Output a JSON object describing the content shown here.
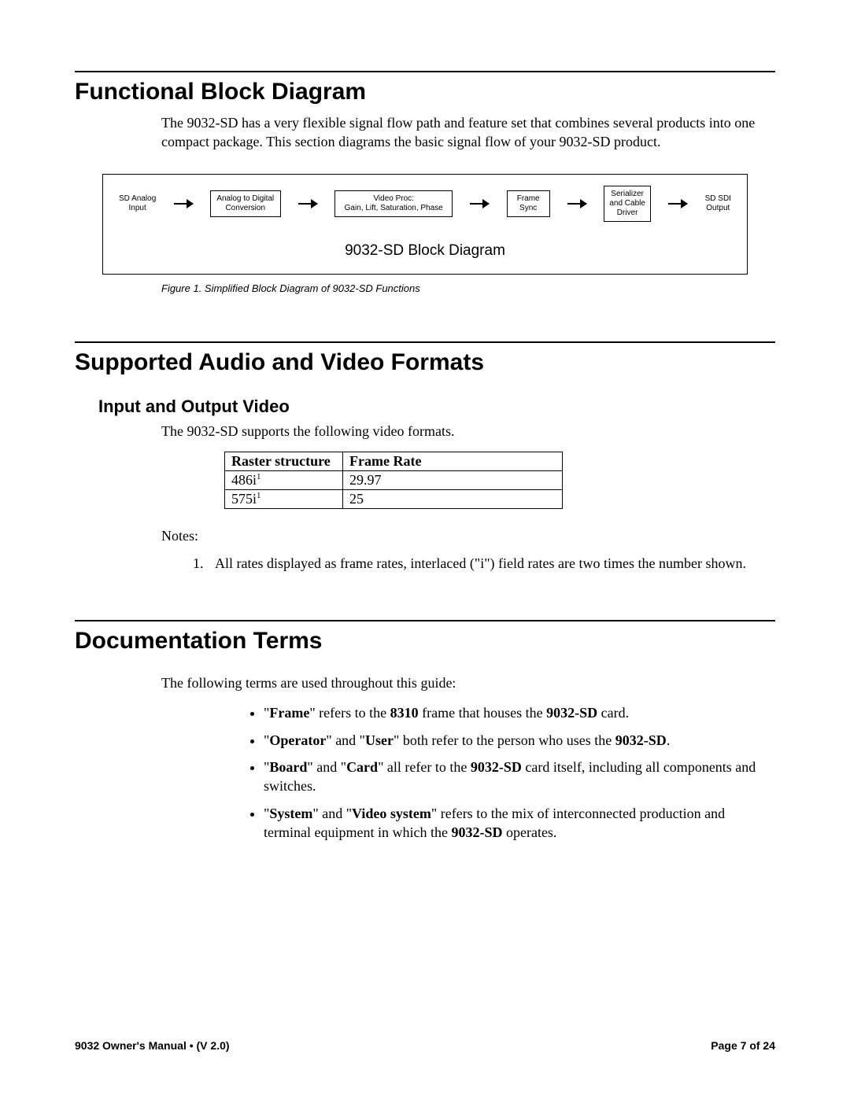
{
  "section1": {
    "heading": "Functional Block Diagram",
    "intro": "The 9032-SD has a very flexible signal flow path and feature set that combines several products into one compact package.  This section diagrams the basic signal flow of your 9032-SD product."
  },
  "diagram": {
    "nodes": {
      "input_l1": "SD Analog",
      "input_l2": "Input",
      "adc_l1": "Analog to Digital",
      "adc_l2": "Conversion",
      "proc_l1": "Video Proc:",
      "proc_l2": "Gain, Lift, Saturation, Phase",
      "frame_l1": "Frame",
      "frame_l2": "Sync",
      "ser_l1": "Serializer",
      "ser_l2": "and Cable",
      "ser_l3": "Driver",
      "output_l1": "SD SDI",
      "output_l2": "Output"
    },
    "caption": "9032-SD Block Diagram",
    "figure_caption": "Figure 1. Simplified Block Diagram of 9032-SD Functions"
  },
  "section2": {
    "heading": "Supported Audio and Video Formats",
    "sub_heading": "Input and Output Video",
    "intro": "The 9032-SD supports the following video formats."
  },
  "video_table": {
    "headers": {
      "c1": "Raster structure",
      "c2": "Frame Rate"
    },
    "rows": [
      {
        "raster": "486i",
        "sup": "1",
        "rate": "29.97"
      },
      {
        "raster": "575i",
        "sup": "1",
        "rate": "25"
      }
    ]
  },
  "notes": {
    "label": "Notes:",
    "items": [
      "All rates displayed as frame rates, interlaced (\"i\") field rates are two times the number shown."
    ]
  },
  "section3": {
    "heading": "Documentation Terms",
    "intro": "The following terms are used throughout this guide:"
  },
  "terms": {
    "t1": {
      "a": "\"",
      "b": "Frame",
      "c": "\" refers to the ",
      "d": "8310",
      "e": " frame that houses the ",
      "f": "9032-SD",
      "g": " card."
    },
    "t2": {
      "a": " \"",
      "b": "Operator",
      "c": "\" and \"",
      "d": "User",
      "e": "\" both refer to the person who uses the ",
      "f": "9032-SD",
      "g": "."
    },
    "t3": {
      "a": "\"",
      "b": "Board",
      "c": "\" and \"",
      "d": "Card",
      "e": "\" all refer to the ",
      "f": "9032-SD",
      "g": " card itself, including all components and switches."
    },
    "t4": {
      "a": "\"",
      "b": "System",
      "c": "\" and \"",
      "d": "Video system",
      "e": "\" refers to the mix of interconnected production and terminal equipment in which the ",
      "f": "9032-SD",
      "g": " operates."
    }
  },
  "footer": {
    "left": "9032 Owner's Manual  •  (V 2.0)",
    "right": "Page 7 of 24"
  }
}
